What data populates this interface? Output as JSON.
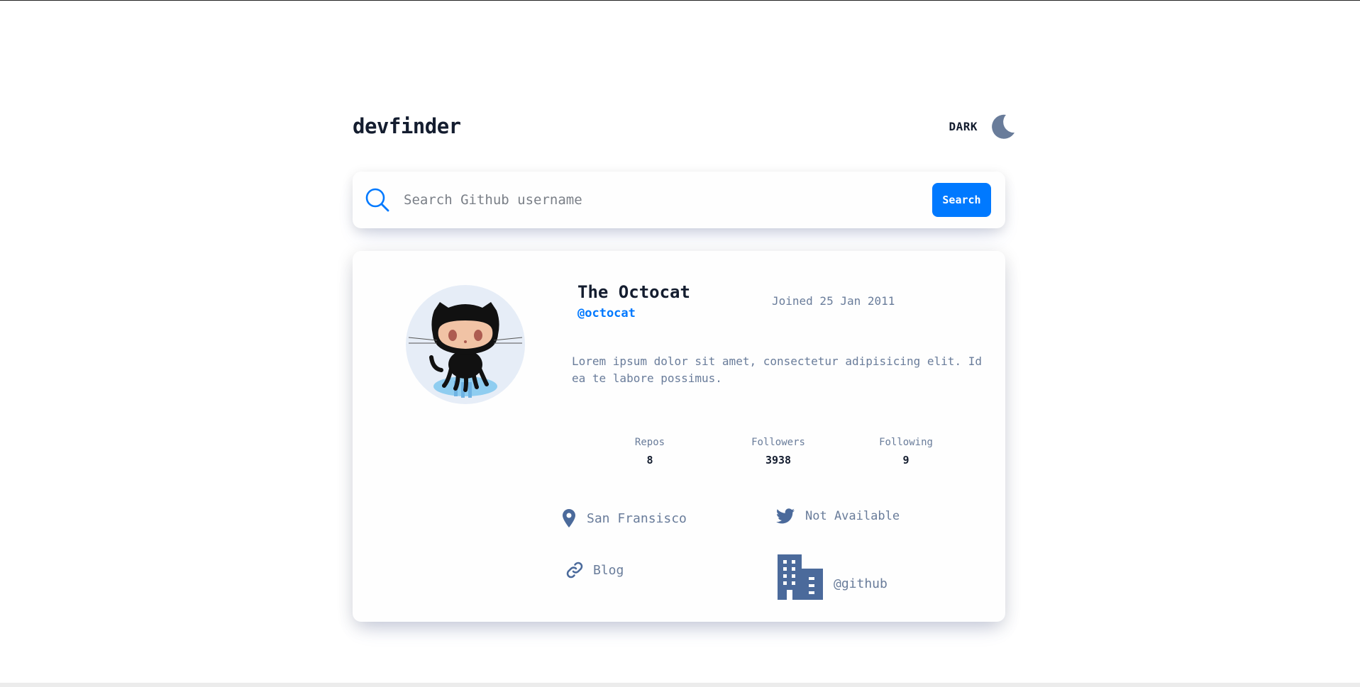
{
  "header": {
    "logo": "devfinder",
    "theme_label": "DARK",
    "theme_icon": "moon-icon"
  },
  "search": {
    "placeholder": "Search Github username",
    "value": "",
    "button_label": "Search",
    "icon": "search-icon"
  },
  "profile": {
    "avatar_icon": "octocat-avatar",
    "name": "The Octocat",
    "login": "@octocat",
    "joined": "Joined 25 Jan 2011",
    "bio": "Lorem ipsum dolor sit amet, consectetur adipisicing elit. Id ea te labore possimus.",
    "stats": [
      {
        "label": "Repos",
        "value": "8"
      },
      {
        "label": "Followers",
        "value": "3938"
      },
      {
        "label": "Following",
        "value": "9"
      }
    ],
    "links": {
      "location": "San Fransisco",
      "twitter": "Not Available",
      "blog": "Blog",
      "company": "@github"
    }
  },
  "colors": {
    "accent": "#0079ff",
    "icon": "#4b6a9b",
    "text_muted": "#697c9a",
    "text_dark": "#141d2f"
  }
}
